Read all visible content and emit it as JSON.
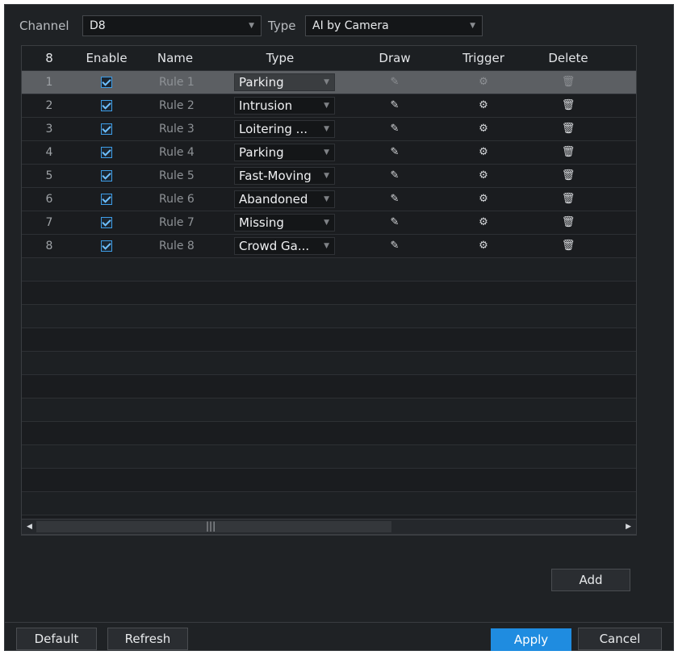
{
  "filters": {
    "channel_label": "Channel",
    "channel_value": "D8",
    "type_label": "Type",
    "type_value": "AI by Camera"
  },
  "table": {
    "headers": [
      "8",
      "Enable",
      "Name",
      "Type",
      "Draw",
      "Trigger",
      "Delete"
    ],
    "rows": [
      {
        "index": "1",
        "enabled": true,
        "name": "Rule 1",
        "type": "Parking"
      },
      {
        "index": "2",
        "enabled": true,
        "name": "Rule 2",
        "type": "Intrusion"
      },
      {
        "index": "3",
        "enabled": true,
        "name": "Rule 3",
        "type": "Loitering ..."
      },
      {
        "index": "4",
        "enabled": true,
        "name": "Rule 4",
        "type": "Parking"
      },
      {
        "index": "5",
        "enabled": true,
        "name": "Rule 5",
        "type": "Fast-Moving"
      },
      {
        "index": "6",
        "enabled": true,
        "name": "Rule 6",
        "type": "Abandoned"
      },
      {
        "index": "7",
        "enabled": true,
        "name": "Rule 7",
        "type": "Missing"
      },
      {
        "index": "8",
        "enabled": true,
        "name": "Rule 8",
        "type": "Crowd Ga..."
      }
    ],
    "selected_row": 0,
    "icons": {
      "draw": "pencil-icon",
      "trigger": "gear-icon",
      "delete": "trash-icon"
    }
  },
  "buttons": {
    "add": "Add",
    "default": "Default",
    "refresh": "Refresh",
    "apply": "Apply",
    "cancel": "Cancel"
  },
  "colors": {
    "background": "#1f2225",
    "accent": "#1f8ce0",
    "selected_row": "#5c5f63"
  }
}
